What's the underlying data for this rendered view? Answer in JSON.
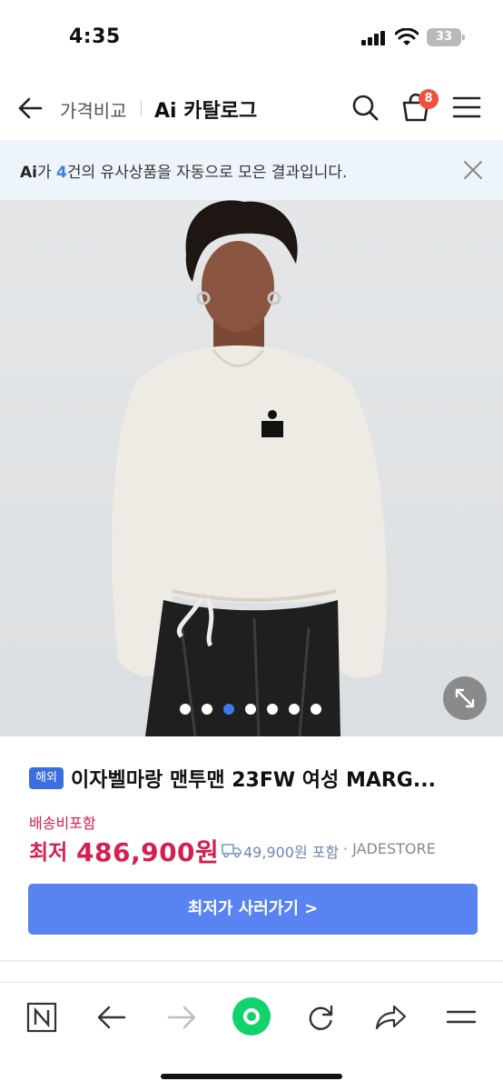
{
  "status_bar": {
    "time": "4:35",
    "battery": "33"
  },
  "header": {
    "crumb": "가격비교",
    "title": "Ai 카탈로그",
    "cart_count": "8"
  },
  "ai_banner": {
    "logo": "Ai",
    "text_before": "가 ",
    "count": "4",
    "text_after": "건의 유사상품을 자동으로 모은 결과입니다."
  },
  "gallery": {
    "slide_count": 7,
    "active_index": 2
  },
  "product": {
    "tag": "해외",
    "name": "이자벨마랑 맨투맨 23FW 여성 MARG...",
    "shipping_included": "배송비포함",
    "price_label": "최저",
    "price": "486,900원",
    "shipping_fee": "49,900원 포함",
    "seller": "· JADESTORE",
    "cta_label": "최저가 사러가기 >"
  },
  "colors": {
    "accent": "#5a83f2",
    "price": "#d61f4b",
    "badge": "#f0513f",
    "active_dot": "#3b7bea"
  },
  "toolbar_icons": [
    "naver-home-icon",
    "back-arrow-icon",
    "forward-arrow-icon",
    "green-dot-icon",
    "refresh-icon",
    "share-icon",
    "menu-icon"
  ]
}
